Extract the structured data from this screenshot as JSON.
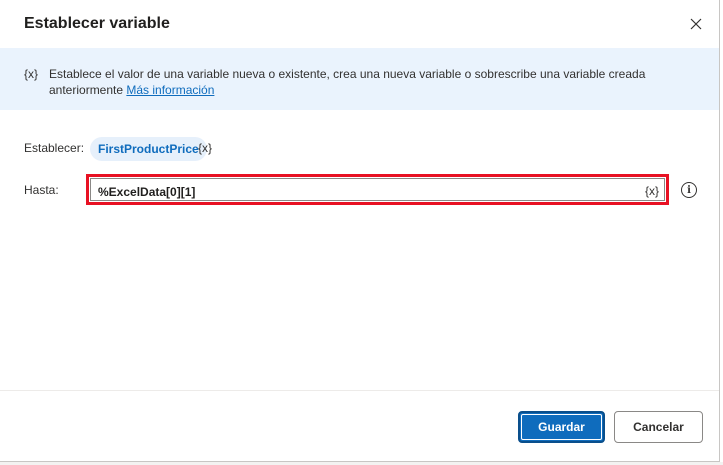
{
  "dialog": {
    "title": "Establecer variable",
    "close_icon": "close-icon"
  },
  "banner": {
    "icon_text": "{x}",
    "description": "Establece el valor de una variable nueva o existente, crea una nueva variable o sobrescribe una variable creada anteriormente ",
    "link_text": "Más información"
  },
  "fields": {
    "set_label": "Establecer:",
    "variable_name": "FirstProductPrice",
    "variable_icon": "{x}",
    "to_label": "Hasta:",
    "to_value": "%ExcelData[0][1]",
    "to_var_icon": "{x}",
    "info_glyph": "i"
  },
  "footer": {
    "save_label": "Guardar",
    "cancel_label": "Cancelar"
  },
  "colors": {
    "accent": "#0f6cbd",
    "highlight_border": "#e81123",
    "banner_bg": "#eaf3fd"
  }
}
